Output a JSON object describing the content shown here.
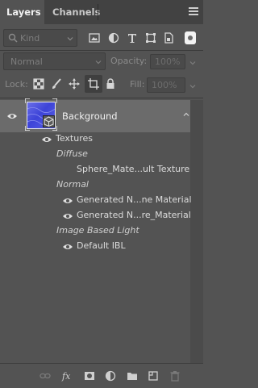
{
  "tabs": [
    {
      "label": "Layers",
      "active": true
    },
    {
      "label": "Channels",
      "active": false
    }
  ],
  "filter": {
    "kind_label": "Kind"
  },
  "blend": {
    "mode": "Normal",
    "opacity_label": "Opacity:",
    "opacity_value": "100%"
  },
  "lock": {
    "label": "Lock:",
    "fill_label": "Fill:",
    "fill_value": "100%"
  },
  "layer": {
    "name": "Background"
  },
  "textures": {
    "header": "Textures",
    "groups": [
      {
        "name": "Diffuse",
        "items": [
          {
            "label": "Sphere_Mate...ult Texture",
            "eye": false
          }
        ]
      },
      {
        "name": "Normal",
        "items": [
          {
            "label": "Generated N...ne Material",
            "eye": true
          },
          {
            "label": "Generated N...re_Material",
            "eye": true
          }
        ]
      },
      {
        "name": "Image Based Light",
        "items": [
          {
            "label": "Default IBL",
            "eye": true
          }
        ]
      }
    ]
  },
  "colors": {
    "panel": "#535353",
    "selected": "#6b6b6b",
    "accent": "#3d44d8"
  }
}
